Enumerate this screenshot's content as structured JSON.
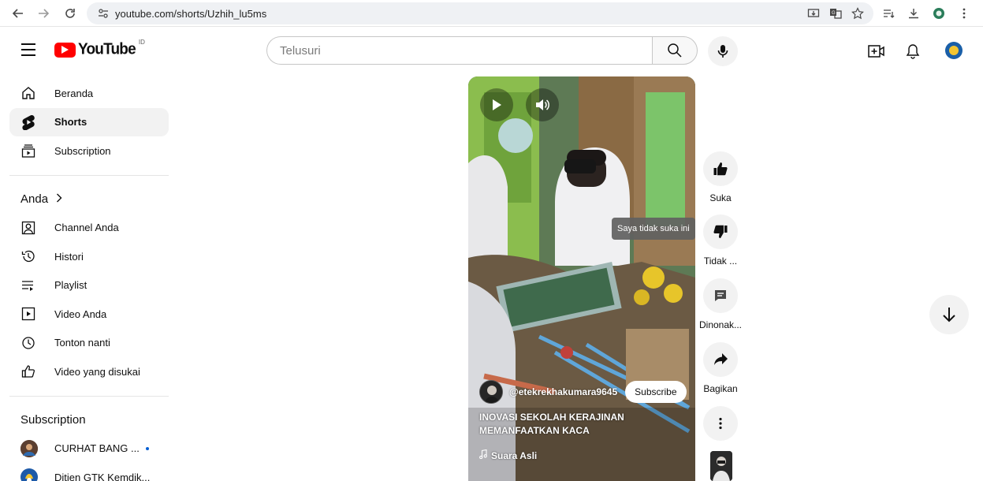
{
  "browser": {
    "url": "youtube.com/shorts/Uzhih_lu5ms"
  },
  "masthead": {
    "logo_text": "YouTube",
    "country_code": "ID",
    "search_placeholder": "Telusuri"
  },
  "sidebar": {
    "main": [
      {
        "label": "Beranda",
        "icon": "home-icon",
        "active": false
      },
      {
        "label": "Shorts",
        "icon": "shorts-icon",
        "active": true
      },
      {
        "label": "Subscription",
        "icon": "subscriptions-icon",
        "active": false
      }
    ],
    "you_heading": "Anda",
    "you_items": [
      {
        "label": "Channel Anda",
        "icon": "your-channel-icon"
      },
      {
        "label": "Histori",
        "icon": "history-icon"
      },
      {
        "label": "Playlist",
        "icon": "playlist-icon"
      },
      {
        "label": "Video Anda",
        "icon": "your-videos-icon"
      },
      {
        "label": "Tonton nanti",
        "icon": "watch-later-icon"
      },
      {
        "label": "Video yang disukai",
        "icon": "liked-videos-icon"
      }
    ],
    "subscriptions_heading": "Subscription",
    "subscriptions": [
      {
        "label": "CURHAT BANG ...",
        "new_content": true
      },
      {
        "label": "Ditjen GTK Kemdik...",
        "new_content": false
      }
    ]
  },
  "short": {
    "channel": "@etekrekhakumara9645",
    "subscribe_label": "Subscribe",
    "title_lines": [
      "INOVASI SEKOLAH KERAJINAN",
      "MEMANFAATKAN KACA"
    ],
    "sound": "Suara Asli",
    "tooltip": "Saya tidak suka ini"
  },
  "actions": {
    "like": "Suka",
    "dislike": "Tidak ...",
    "comments": "Dinonak...",
    "share": "Bagikan"
  },
  "colors": {
    "brand_red": "#ff0000",
    "active_bg": "#f2f2f2",
    "unread_dot": "#065fd4"
  }
}
